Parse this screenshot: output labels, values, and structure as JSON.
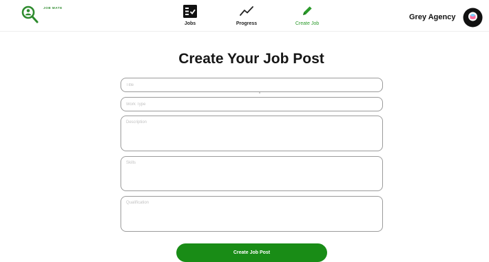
{
  "app": {
    "logo_text": "JOB MATE",
    "logo_icon": "magnifier-person-icon",
    "brand_color": "#2e8b2e"
  },
  "nav": {
    "items": [
      {
        "label": "Jobs",
        "icon": "job-list-icon",
        "active": false
      },
      {
        "label": "Progress",
        "icon": "trend-line-icon",
        "active": false
      },
      {
        "label": "Create Job",
        "icon": "pencil-icon",
        "active": true
      }
    ],
    "active_color": "#2a9a2a"
  },
  "user": {
    "agency_name": "Grey Agency",
    "avatar_icon": "avatar-icon"
  },
  "form": {
    "title": "Create Your Job Post",
    "fields": {
      "title": {
        "placeholder": "Title",
        "value": ""
      },
      "work_type": {
        "placeholder": "Work Type",
        "value": ""
      },
      "description": {
        "placeholder": "Description",
        "value": ""
      },
      "skills": {
        "placeholder": "Skills",
        "value": ""
      },
      "qualification": {
        "placeholder": "Qualification",
        "value": ""
      }
    },
    "submit_label": "Create Job Post",
    "submit_color": "#198c16"
  }
}
